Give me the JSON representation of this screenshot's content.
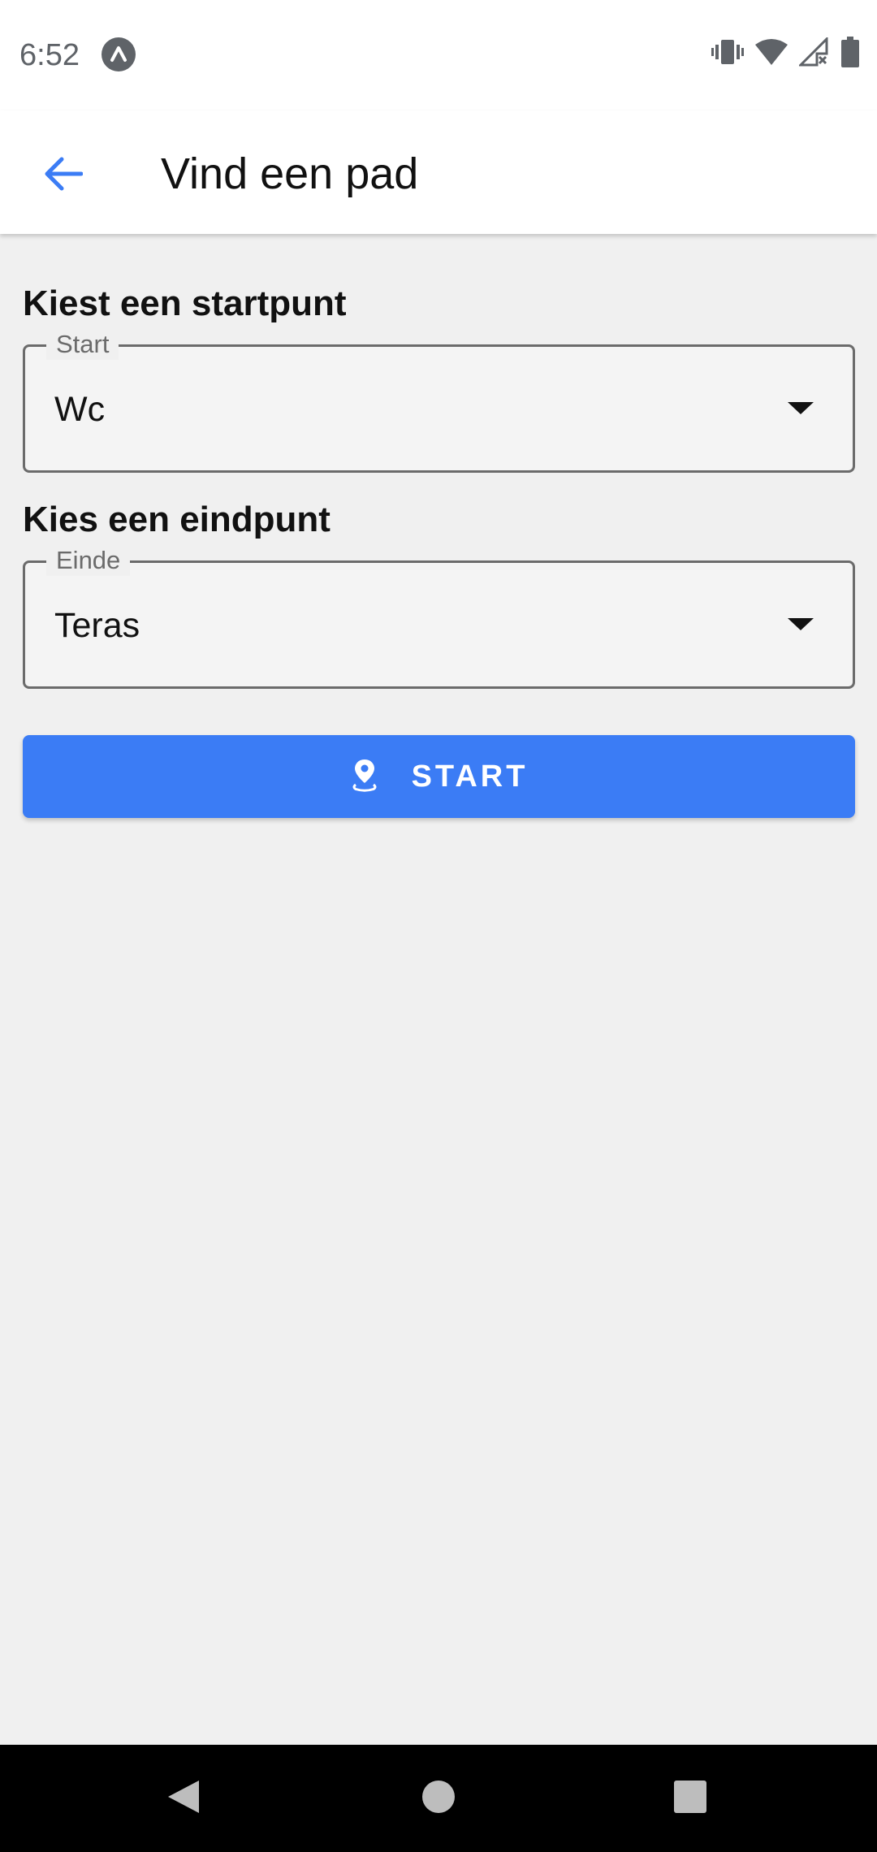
{
  "status_bar": {
    "time": "6:52",
    "icons": [
      "app-notification-icon",
      "vibrate-icon",
      "wifi-icon",
      "cellular-no-signal-icon",
      "battery-icon"
    ]
  },
  "app_bar": {
    "title": "Vind een pad",
    "back_icon": "arrow-back-icon"
  },
  "start_section": {
    "heading": "Kiest een startpunt",
    "field_label": "Start",
    "selected_value": "Wc"
  },
  "end_section": {
    "heading": "Kies een eindpunt",
    "field_label": "Einde",
    "selected_value": "Teras"
  },
  "action_button": {
    "label": "START",
    "icon": "location-pin-icon"
  },
  "nav_bar": {
    "buttons": [
      "back-triangle-icon",
      "home-circle-icon",
      "recents-square-icon"
    ]
  },
  "colors": {
    "accent": "#3b7cf5",
    "app_bar": "#ffffff",
    "background": "#f0f0f0",
    "nav_bar": "#000000"
  }
}
